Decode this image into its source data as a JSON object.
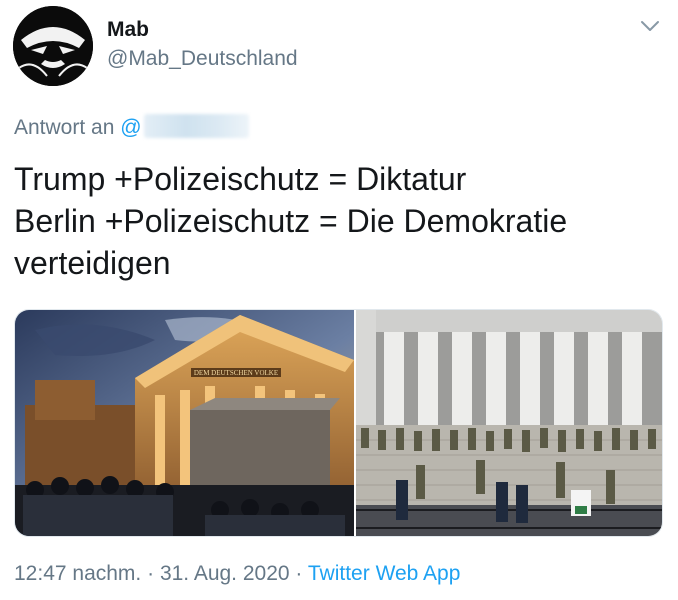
{
  "author": {
    "display_name": "Mab",
    "handle": "@Mab_Deutschland"
  },
  "reply": {
    "prefix": "Antwort an",
    "mention": "@"
  },
  "tweet": {
    "lines": [
      "Trump +Polizeischutz = Diktatur",
      "Berlin +Polizeischutz = Die Demokratie",
      "verteidigen"
    ]
  },
  "media": {
    "left_inscription": "DEM DEUTSCHEN VOLKE"
  },
  "meta": {
    "time": "12:47 nachm.",
    "separator": "·",
    "date": "31. Aug. 2020",
    "source": "Twitter Web App"
  },
  "icons": {
    "menu": "chevron-down-icon",
    "avatar": "avatar-mask-icon"
  },
  "colors": {
    "link": "#1da1f2",
    "secondary_text": "#657786",
    "primary_text": "#14171a"
  }
}
